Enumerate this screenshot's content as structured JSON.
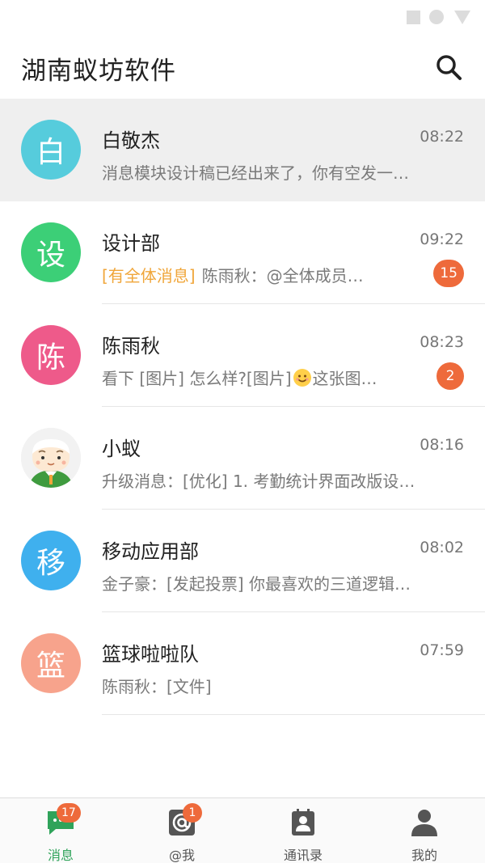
{
  "header": {
    "title": "湖南蚁坊软件"
  },
  "conversations": [
    {
      "avatar_text": "白",
      "avatar_color": "#56ccdc",
      "name": "白敬杰",
      "time": "08:22",
      "tag": "",
      "preview": "消息模块设计稿已经出来了，你有空发一…",
      "badge": ""
    },
    {
      "avatar_text": "设",
      "avatar_color": "#3ccf77",
      "name": "设计部",
      "time": "09:22",
      "tag": "[有全体消息]",
      "preview": "陈雨秋：@全体成员…",
      "badge": "15"
    },
    {
      "avatar_text": "陈",
      "avatar_color": "#ee5a8a",
      "name": "陈雨秋",
      "time": "08:23",
      "tag": "",
      "preview_a": "看下 [图片] 怎么样?[图片]",
      "preview_b": "这张图…",
      "badge": "2"
    },
    {
      "avatar_text": "",
      "avatar_color": "#f2f2f2",
      "name": "小蚁",
      "time": "08:16",
      "tag": "",
      "preview": "升级消息：[优化] 1. 考勤统计界面改版设…",
      "badge": ""
    },
    {
      "avatar_text": "移",
      "avatar_color": "#3fb0ee",
      "name": "移动应用部",
      "time": "08:02",
      "tag": "",
      "preview": "金子豪：[发起投票] 你最喜欢的三道逻辑…",
      "badge": ""
    },
    {
      "avatar_text": "篮",
      "avatar_color": "#f7a38c",
      "name": "篮球啦啦队",
      "time": "07:59",
      "tag": "",
      "preview": "陈雨秋：[文件]",
      "badge": ""
    }
  ],
  "nav": [
    {
      "label": "消息",
      "badge": "17",
      "icon": "chat-icon",
      "active": true
    },
    {
      "label": "@我",
      "badge": "1",
      "icon": "at-icon",
      "active": false
    },
    {
      "label": "通讯录",
      "badge": "",
      "icon": "contacts-icon",
      "active": false
    },
    {
      "label": "我的",
      "badge": "",
      "icon": "person-icon",
      "active": false
    }
  ],
  "colors": {
    "accent_green": "#2fa35a",
    "badge_orange": "#ee6a3b",
    "tag_yellow": "#f0a63a"
  }
}
